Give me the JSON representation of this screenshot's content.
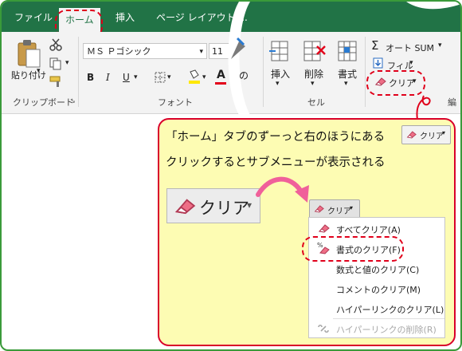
{
  "tabs": {
    "file": "ファイル",
    "home": "ホーム",
    "insert": "挿入",
    "page_layout": "ページ レイアウト ..."
  },
  "clipboard": {
    "paste_label": "貼り付け",
    "group_label": "クリップボード"
  },
  "font": {
    "font_name": "ＭＳ Ｐゴシック",
    "font_size": "11",
    "bold": "B",
    "italic": "I",
    "underline": "U",
    "font_color_letter": "A",
    "group_label": "フォント"
  },
  "cells": {
    "insert_label": "挿入",
    "delete_label": "削除",
    "format_label": "書式",
    "group_label": "セル"
  },
  "editing": {
    "autosum_label": "オート SUM",
    "fill_label": "フィル",
    "clear_label": "クリア",
    "group_label_partial": "編"
  },
  "callout": {
    "line1": "「ホーム」タブのずーっと右のほうにある",
    "line2": "クリックするとサブメニューが表示される",
    "clear_button_small": "クリア",
    "clear_button_big": "クリア",
    "clear_button_menu": "クリア"
  },
  "clear_menu": {
    "items": [
      {
        "label": "すべてクリア(A)",
        "icon": "eraser-icon",
        "enabled": true
      },
      {
        "label": "書式のクリア(F)",
        "icon": "format-eraser-icon",
        "enabled": true
      },
      {
        "label": "数式と値のクリア(C)",
        "icon": "",
        "enabled": true
      },
      {
        "label": "コメントのクリア(M)",
        "icon": "",
        "enabled": true
      },
      {
        "label": "ハイパーリンクのクリア(L)",
        "icon": "",
        "enabled": true
      },
      {
        "label": "ハイパーリンクの削除(R)",
        "icon": "unlink-icon",
        "enabled": false
      }
    ]
  },
  "colors": {
    "ribbon_green": "#217346",
    "highlight_red": "#e0001b",
    "callout_fill": "#fdfcb3",
    "arrow_pink": "#f0609a",
    "frame_green": "#3a9a3a"
  }
}
